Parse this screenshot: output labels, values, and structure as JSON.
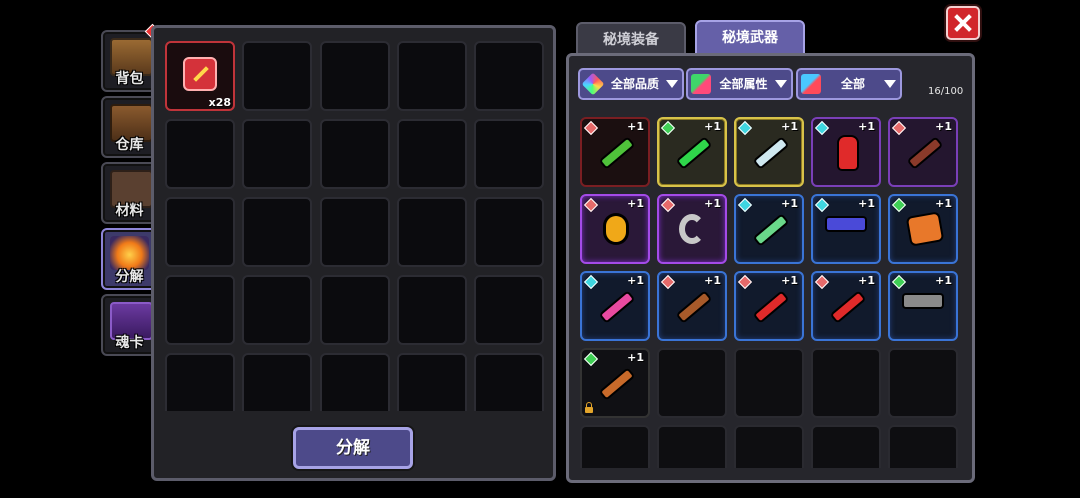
{
  "side_tabs": [
    {
      "label": "背包",
      "icon": "chest-icon"
    },
    {
      "label": "仓库",
      "icon": "warehouse-icon"
    },
    {
      "label": "材料",
      "icon": "materials-icon"
    },
    {
      "label": "分解",
      "icon": "furnace-icon"
    },
    {
      "label": "魂卡",
      "icon": "soul-card-icon"
    }
  ],
  "left_panel": {
    "first_item": {
      "icon": "red-weapon-icon",
      "count": "x28"
    },
    "decompose_label": "分解"
  },
  "top_tabs": [
    {
      "label": "秘境装备"
    },
    {
      "label": "秘境武器"
    }
  ],
  "filters": [
    {
      "label": "全部品质",
      "icon": "rainbow-gem-icon"
    },
    {
      "label": "全部属性",
      "icon": "element-icon"
    },
    {
      "label": "全部",
      "icon": "weapon-type-icon"
    }
  ],
  "capacity": "16/100",
  "weapons": [
    {
      "name": "green-sword",
      "plus": "+1",
      "rarity": "red",
      "gem": "#e66a6a",
      "locked": false
    },
    {
      "name": "green-serpent-whip",
      "plus": "+1",
      "rarity": "gold",
      "gem": "#3fcf55",
      "locked": false
    },
    {
      "name": "crystal-sword",
      "plus": "+1",
      "rarity": "gold",
      "gem": "#3fd6e0",
      "locked": false
    },
    {
      "name": "fire-extinguisher",
      "plus": "+1",
      "rarity": "purple",
      "gem": "#3fd6e0",
      "locked": false
    },
    {
      "name": "brown-crossbow",
      "plus": "+1",
      "rarity": "purple",
      "gem": "#e66a6a",
      "locked": false
    },
    {
      "name": "golden-amulet",
      "plus": "+1",
      "rarity": "purple2",
      "gem": "#e66a6a",
      "locked": false
    },
    {
      "name": "iron-hook",
      "plus": "+1",
      "rarity": "purple2",
      "gem": "#e66a6a",
      "locked": false
    },
    {
      "name": "jade-dagger",
      "plus": "+1",
      "rarity": "blue",
      "gem": "#3fd6e0",
      "locked": false
    },
    {
      "name": "blue-pistol",
      "plus": "+1",
      "rarity": "blue",
      "gem": "#3fd6e0",
      "locked": false
    },
    {
      "name": "orange-brick",
      "plus": "+1",
      "rarity": "blue",
      "gem": "#3fcf55",
      "locked": false
    },
    {
      "name": "pink-drill",
      "plus": "+1",
      "rarity": "blue",
      "gem": "#3fd6e0",
      "locked": false
    },
    {
      "name": "wooden-rifle",
      "plus": "+1",
      "rarity": "blue",
      "gem": "#e66a6a",
      "locked": false
    },
    {
      "name": "red-sword-a",
      "plus": "+1",
      "rarity": "blue",
      "gem": "#e66a6a",
      "locked": false
    },
    {
      "name": "red-sword-b",
      "plus": "+1",
      "rarity": "blue",
      "gem": "#e66a6a",
      "locked": false
    },
    {
      "name": "gray-pistol",
      "plus": "+1",
      "rarity": "blue",
      "gem": "#3fcf55",
      "locked": false
    },
    {
      "name": "brown-club",
      "plus": "+1",
      "rarity": "empty",
      "gem": "#3fcf55",
      "locked": true
    }
  ]
}
